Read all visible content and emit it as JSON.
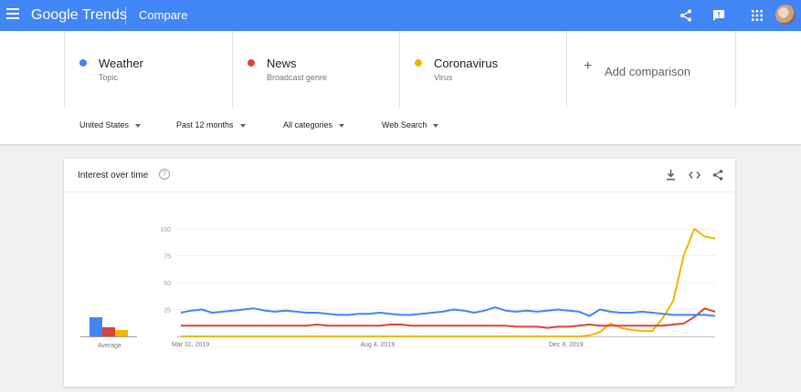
{
  "header": {
    "brand_google": "Google",
    "brand_trends": "Trends",
    "section": "Compare"
  },
  "compare": {
    "terms": [
      {
        "name": "Weather",
        "type": "Topic",
        "color": "#4285f4"
      },
      {
        "name": "News",
        "type": "Broadcast genre",
        "color": "#db4437"
      },
      {
        "name": "Coronavirus",
        "type": "Virus",
        "color": "#f4b400"
      }
    ],
    "add_label": "Add comparison"
  },
  "filters": {
    "region": "United States",
    "period": "Past 12 months",
    "category": "All categories",
    "property": "Web Search"
  },
  "widget": {
    "title": "Interest over time"
  },
  "chart_data": [
    {
      "type": "bar",
      "categories": [
        "Weather",
        "News",
        "Coronavirus"
      ],
      "values": [
        21,
        10,
        7
      ],
      "xlabel": "Average",
      "colors": [
        "#4285f4",
        "#db4437",
        "#f4b400"
      ]
    },
    {
      "type": "line",
      "ylim": [
        0,
        100
      ],
      "yticks": [
        25,
        50,
        75,
        100
      ],
      "xtick_labels": [
        {
          "label": "Mar 31, 2019",
          "index": 0
        },
        {
          "label": "Aug 4, 2019",
          "index": 18
        },
        {
          "label": "Dec 8, 2019",
          "index": 36
        }
      ],
      "grid": true,
      "series": [
        {
          "name": "Weather",
          "color": "#4285f4",
          "values": [
            22,
            24,
            25,
            22,
            23,
            24,
            25,
            26,
            24,
            23,
            24,
            23,
            22,
            22,
            21,
            20,
            20,
            21,
            21,
            22,
            21,
            20,
            20,
            21,
            22,
            23,
            25,
            24,
            22,
            24,
            27,
            24,
            23,
            24,
            23,
            24,
            25,
            24,
            23,
            19,
            25,
            23,
            22,
            22,
            23,
            22,
            21,
            20,
            20,
            20,
            20,
            19
          ]
        },
        {
          "name": "News",
          "color": "#db4437",
          "values": [
            10,
            10,
            10,
            10,
            10,
            10,
            10,
            10,
            10,
            10,
            10,
            10,
            10,
            11,
            10,
            10,
            10,
            10,
            10,
            10,
            11,
            11,
            10,
            10,
            10,
            10,
            10,
            10,
            10,
            10,
            10,
            10,
            9,
            9,
            9,
            8,
            9,
            9,
            10,
            11,
            10,
            10,
            10,
            10,
            10,
            10,
            10,
            11,
            12,
            18,
            26,
            23
          ]
        },
        {
          "name": "Coronavirus",
          "color": "#f4b400",
          "values": [
            0,
            0,
            0,
            0,
            0,
            0,
            0,
            0,
            0,
            0,
            0,
            0,
            0,
            0,
            0,
            0,
            0,
            0,
            0,
            0,
            0,
            0,
            0,
            0,
            0,
            0,
            0,
            0,
            0,
            0,
            0,
            0,
            0,
            0,
            0,
            0,
            0,
            0,
            0,
            1,
            4,
            12,
            8,
            6,
            5,
            5,
            17,
            33,
            75,
            100,
            93,
            91
          ]
        }
      ]
    }
  ]
}
